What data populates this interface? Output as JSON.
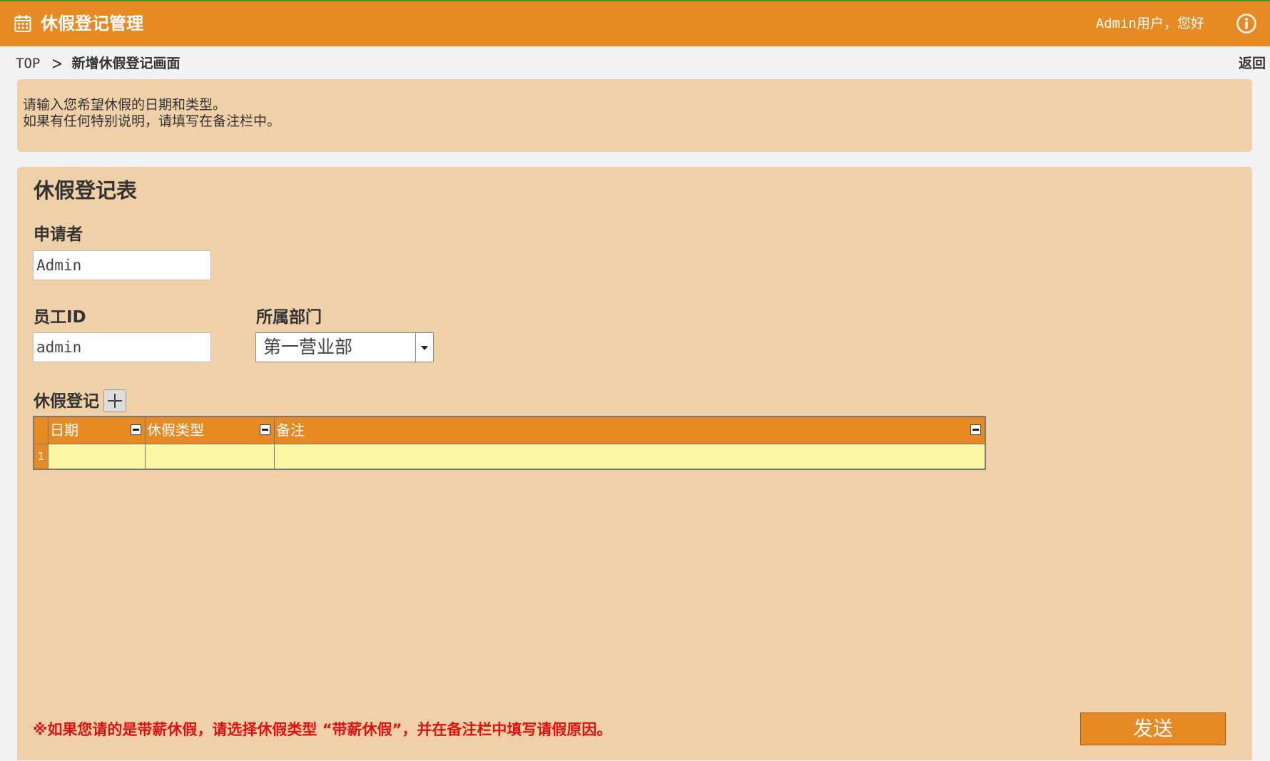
{
  "header": {
    "title": "休假登记管理",
    "greeting": "Admin用户，您好",
    "icons": {
      "app": "calendar-icon",
      "info": "info-icon"
    }
  },
  "breadcrumb": {
    "top": "TOP",
    "separator": ">",
    "current": "新增休假登记画面",
    "back": "返回"
  },
  "notice": {
    "line1": "请输入您希望休假的日期和类型。",
    "line2": "如果有任何特别说明，请填写在备注栏中。"
  },
  "form": {
    "title": "休假登记表",
    "applicant": {
      "label": "申请者",
      "value": "Admin"
    },
    "employee_id": {
      "label": "员工ID",
      "value": "admin"
    },
    "department": {
      "label": "所属部门",
      "selected": "第一营业部"
    },
    "leave_section": {
      "label": "休假登记"
    },
    "grid": {
      "columns": [
        "日期",
        "休假类型",
        "备注"
      ],
      "rows": [
        {
          "num": "1",
          "cells": [
            "",
            "",
            ""
          ]
        }
      ]
    },
    "footnote": "※如果您请的是带薪休假，请选择休假类型 “带薪休假”，并在备注栏中填写请假原因。",
    "submit_label": "发送"
  },
  "colors": {
    "accent": "#e78a24",
    "panel": "#f0d0a8",
    "row": "#faf5a0",
    "warning": "#e01010"
  }
}
